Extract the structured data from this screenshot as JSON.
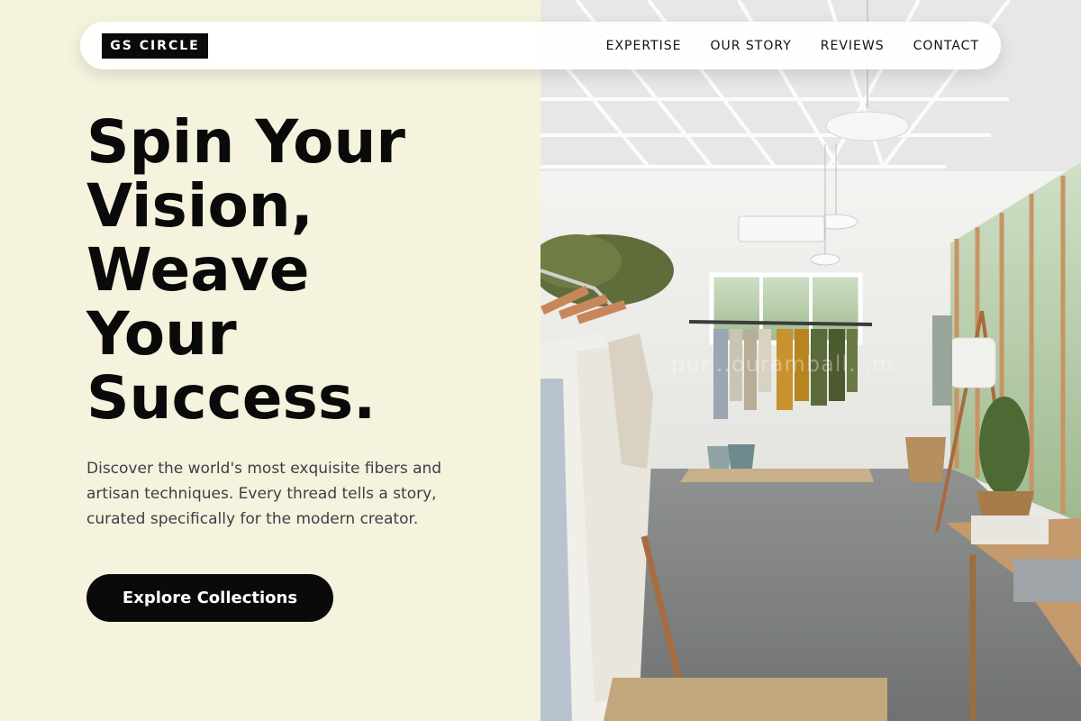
{
  "brand": {
    "logo_text": "GS CIRCLE"
  },
  "nav": {
    "items": [
      {
        "label": "EXPERTISE"
      },
      {
        "label": "OUR STORY"
      },
      {
        "label": "REVIEWS"
      },
      {
        "label": "CONTACT"
      }
    ]
  },
  "hero": {
    "title_lines": [
      "Spin Your",
      "Vision,",
      "Weave",
      "Your",
      "Success."
    ],
    "description": "Discover the world's most exquisite fibers and artisan techniques. Every thread tells a story, curated specifically for the modern creator.",
    "cta_label": "Explore Collections"
  },
  "photo": {
    "subject": "boutique-clothing-store-interior",
    "watermark_text": "pur...ouramball...m"
  },
  "colors": {
    "left_background": "#f5f3dd",
    "primary_dark": "#0a0a0a",
    "body_text": "#3a3f47",
    "navbar_bg": "#ffffff"
  }
}
